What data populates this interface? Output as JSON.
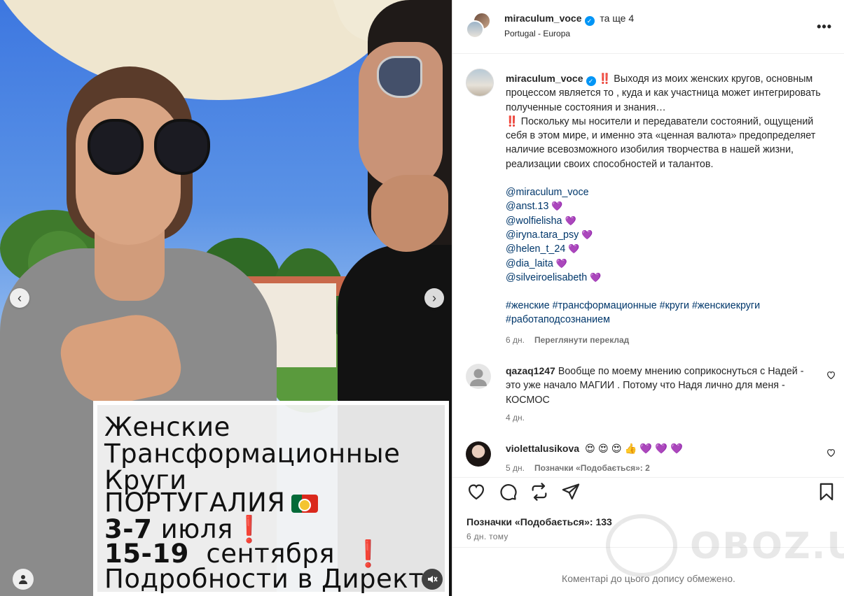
{
  "media": {
    "caption_lines": [
      "Женские",
      "Трансформационные",
      "Круги",
      "ПОРТУГАЛИЯ"
    ],
    "date1_bold": "3-7",
    "date1_rest": "июля",
    "date2_bold": "15-19",
    "date2_rest": "сентября",
    "last_line": "Подробности в Директ",
    "exclamation": "❗",
    "nav_prev": "‹",
    "nav_next": "›"
  },
  "header": {
    "username": "miraculum_voce",
    "and_more": "та ще 4",
    "location": "Portugal - Europa",
    "more_label": "•••"
  },
  "post": {
    "username": "miraculum_voce",
    "p1": "Выходя из моих женских кругов, основным процессом является то , куда и как участница может интегрировать полученные состояния и знания…",
    "p2": "Поскольку мы носители и передаватели состояний, ощущений себя в этом мире, и именно эта «ценная валюта» предопределяет наличие всевозможного изобилия творчества в нашей жизни, реализации своих способностей и талантов.",
    "bang": "‼️",
    "mentions": [
      "@miraculum_voce",
      "@anst.13",
      "@wolfielisha",
      "@iryna.tara_psy",
      "@helen_t_24",
      "@dia_laita",
      "@silveiroelisabeth"
    ],
    "mention_hearts": [
      "",
      "💜",
      "💜",
      "💜",
      "💜",
      "💜",
      "💜"
    ],
    "hashtags": "#женские #трансформационные #круги #женскиекруги #работаподсознанием",
    "age": "6 дн.",
    "translate": "Переглянути переклад"
  },
  "comments": [
    {
      "username": "qazaq1247",
      "text": "Вообще по моему мнению соприкоснуться с Надей - это уже начало МАГИИ . Потому что Надя лично для меня - КОСМОС",
      "age": "4 дн.",
      "likes": ""
    },
    {
      "username": "violettalusikova",
      "text": "😍 😍 😍 👍 💜 💜 💜",
      "age": "5 дн.",
      "likes": "Позначки «Подобається»: 2"
    }
  ],
  "actions": {
    "likes": "Позначки «Подобається»: 133",
    "posted": "6 дн. тому"
  },
  "footer": {
    "text": "Коментарі до цього допису обмежено."
  },
  "watermark": {
    "text": "OBOZ.UA"
  },
  "colors": {
    "link": "#00376b",
    "verified": "#0095f6",
    "muted": "#737373"
  }
}
